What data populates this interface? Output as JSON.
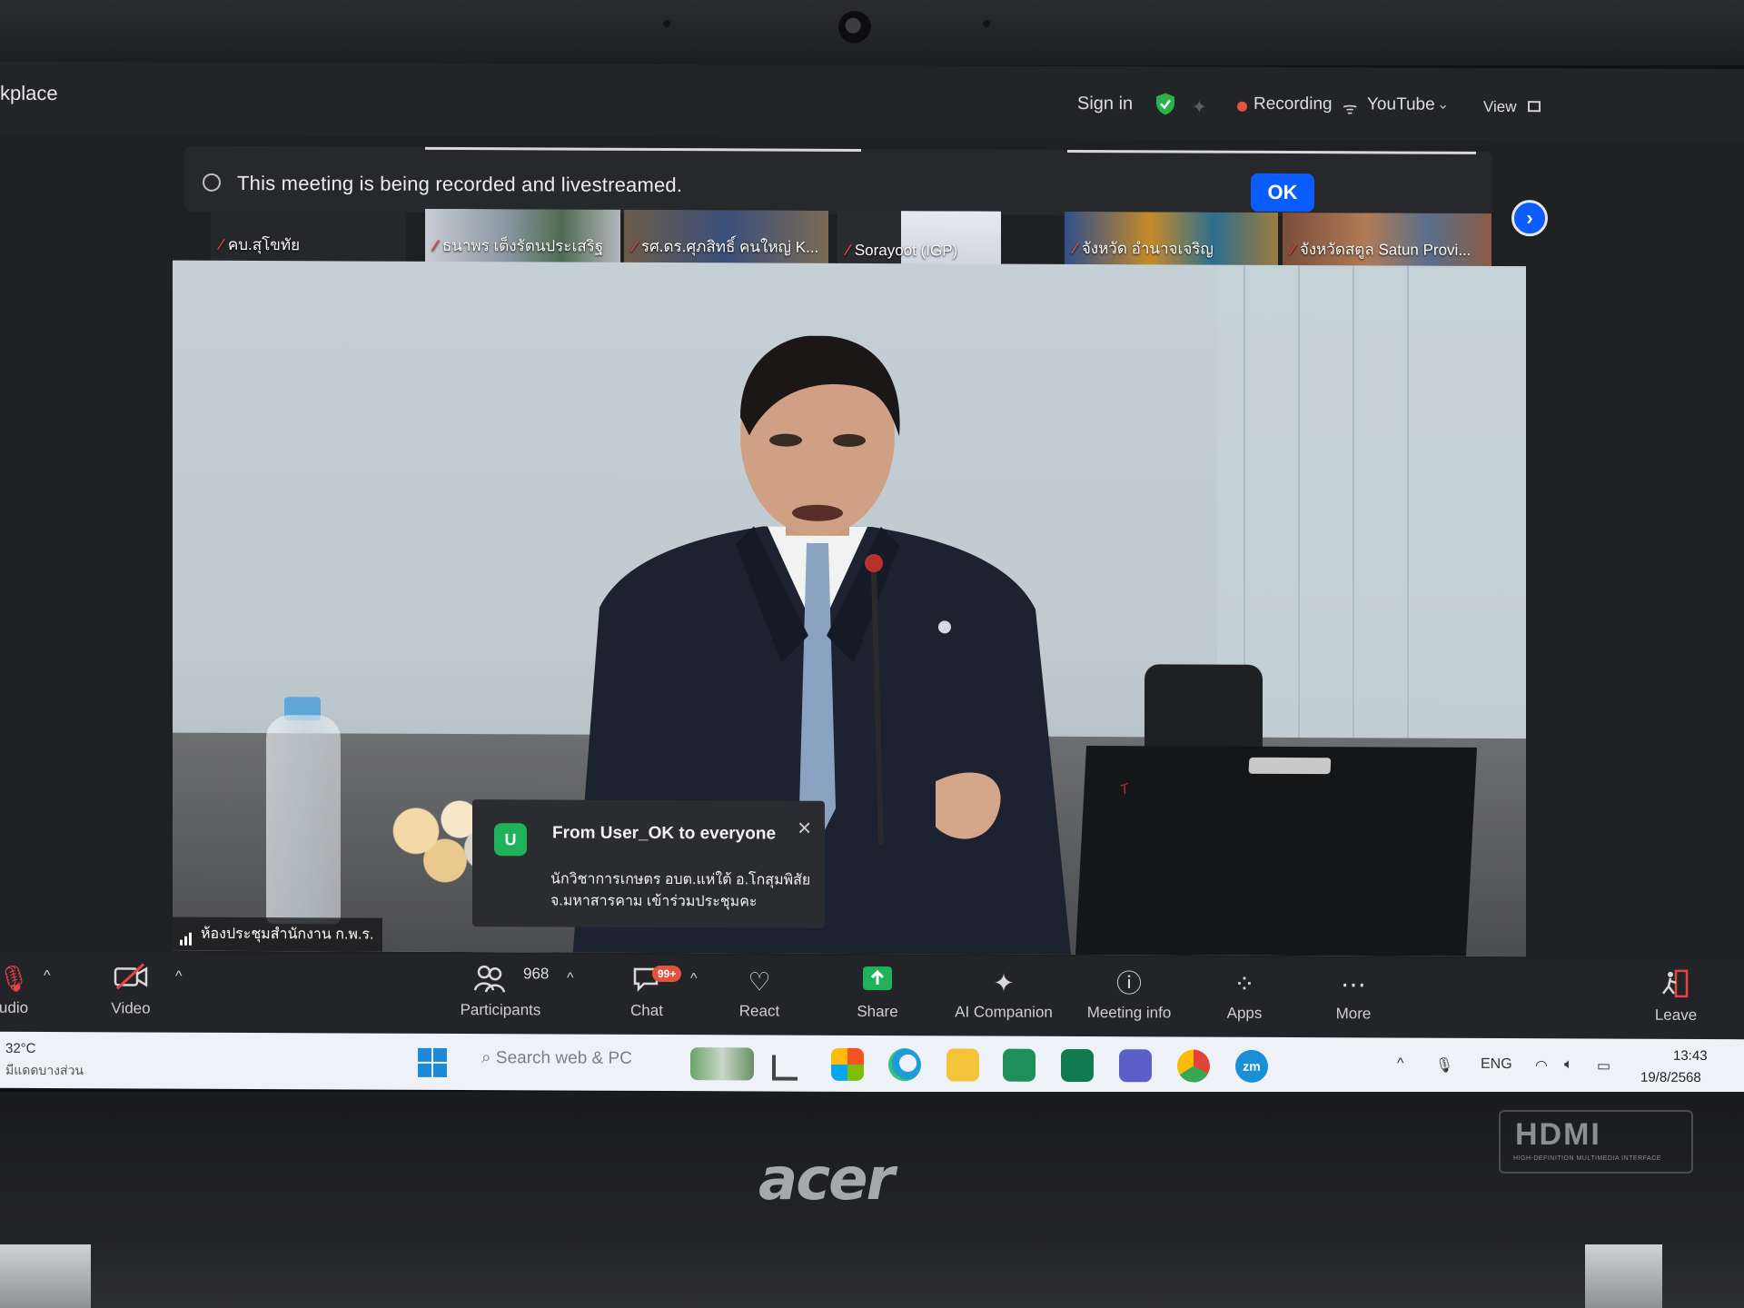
{
  "window": {
    "title_fragment": "kplace"
  },
  "topbar": {
    "sign_in": "Sign in",
    "recording_label": "Recording",
    "stream_label": "YouTube",
    "view_label": "View"
  },
  "banner": {
    "message": "This meeting is being recorded and livestreamed.",
    "ok_label": "OK"
  },
  "participants_strip": [
    {
      "name": "คบ.สุโขทัย"
    },
    {
      "name": "ธนาพร เต็งรัตนประเสริฐ"
    },
    {
      "name": "รศ.ดร.ศุภสิทธิ์ คนใหญ่ K..."
    },
    {
      "name": "Sorayoot (IGP)"
    },
    {
      "name": "จังหวัด อำนาจเจริญ"
    },
    {
      "name": "จังหวัดสตูล Satun Provi..."
    }
  ],
  "main_video": {
    "room_label": "ห้องประชุมสำนักงาน ก.พ.ร."
  },
  "chat_toast": {
    "avatar_letter": "U",
    "title": "From User_OK to everyone",
    "body": "นักวิชาการเกษตร อบต.แห่ใต้ อ.โกสุมพิสัย จ.มหาสารคาม เข้าร่วมประชุมคะ"
  },
  "toolbar": {
    "audio_label": "udio",
    "video_label": "Video",
    "participants_label": "Participants",
    "participants_count": "968",
    "chat_label": "Chat",
    "chat_badge": "99+",
    "react_label": "React",
    "share_label": "Share",
    "ai_label": "AI Companion",
    "meeting_info_label": "Meeting info",
    "apps_label": "Apps",
    "more_label": "More",
    "leave_label": "Leave"
  },
  "taskbar": {
    "weather_temp": "32°C",
    "weather_desc": "มีแดดบางส่วน",
    "search_placeholder": "Search web & PC",
    "language": "ENG",
    "time": "13:43",
    "date": "19/8/2568"
  },
  "hardware": {
    "brand": "acer",
    "hdmi_text": "HDMI",
    "hdmi_subtext": "HIGH-DEFINITION MULTIMEDIA INTERFACE"
  },
  "colors": {
    "zoom_blue": "#0b5cff",
    "recording_red": "#e5533d",
    "mic_off_red": "#e64343",
    "chat_avatar_green": "#1fb25a",
    "share_green": "#1fb25a"
  }
}
